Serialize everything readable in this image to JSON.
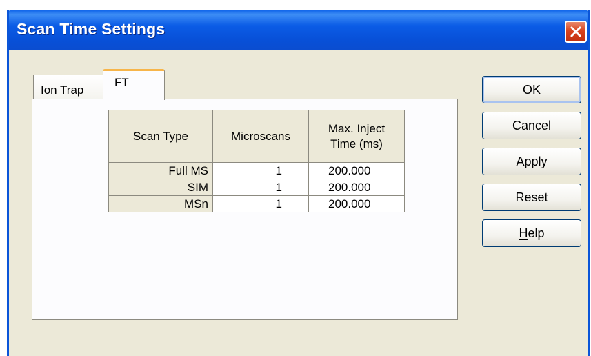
{
  "window": {
    "title": "Scan Time Settings"
  },
  "tabs": [
    {
      "label": "Ion Trap",
      "selected": false
    },
    {
      "label": "FT",
      "selected": true
    }
  ],
  "grid": {
    "headers": {
      "scan_type": "Scan Type",
      "microscans": "Microscans",
      "max_inject": "Max. Inject Time (ms)"
    },
    "rows": [
      {
        "scan_type": "Full MS",
        "microscans": "1",
        "max_inject": "200.000"
      },
      {
        "scan_type": "SIM",
        "microscans": "1",
        "max_inject": "200.000"
      },
      {
        "scan_type": "MSn",
        "microscans": "1",
        "max_inject": "200.000"
      }
    ]
  },
  "buttons": {
    "ok": "OK",
    "cancel": "Cancel",
    "apply": "Apply",
    "reset": "Reset",
    "help": "Help"
  },
  "icons": {
    "close": "close-icon"
  },
  "colors": {
    "titlebar": "#0a55d8",
    "dialog_bg": "#ece9d8",
    "close_button": "#d8431e",
    "active_tab_highlight": "#f7b54a"
  }
}
